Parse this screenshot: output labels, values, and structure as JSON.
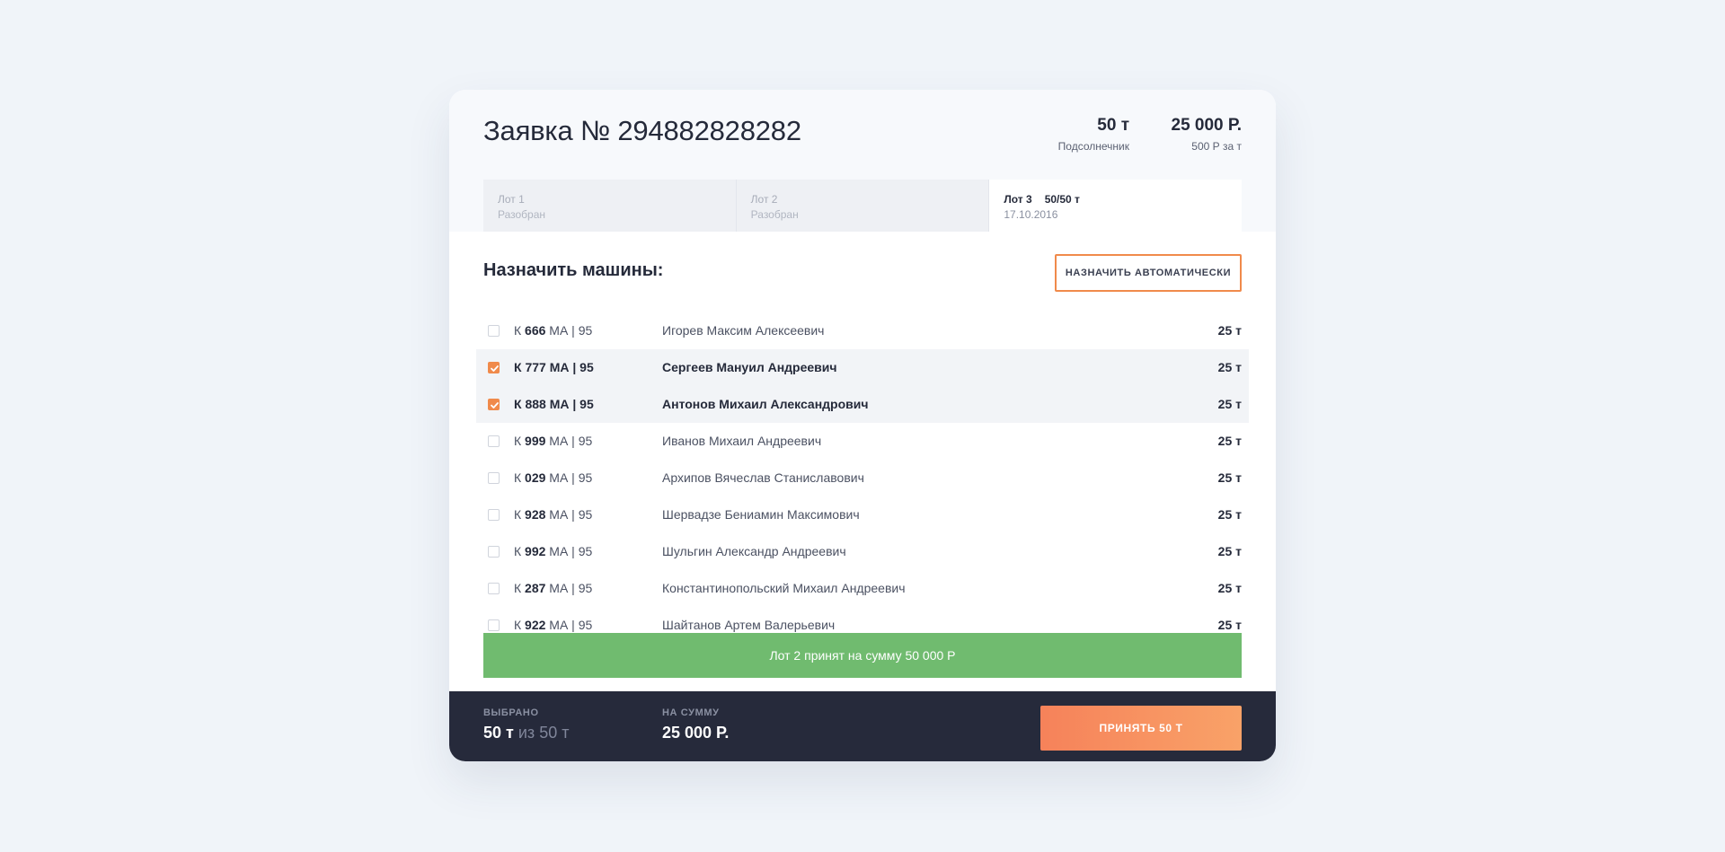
{
  "header": {
    "title": "Заявка № 294882828282",
    "weight_value": "50 т",
    "weight_caption": "Подсолнечник",
    "price_value": "25 000 Р.",
    "price_caption": "500 Р за т"
  },
  "tabs": [
    {
      "title": "Лот 1",
      "capacity": "",
      "subtitle": "Разобран",
      "active": false
    },
    {
      "title": "Лот 2",
      "capacity": "",
      "subtitle": "Разобран",
      "active": false
    },
    {
      "title": "Лот 3",
      "capacity": "50/50 т",
      "subtitle": "17.10.2016",
      "active": true
    }
  ],
  "assign": {
    "title": "Назначить машины:",
    "auto_button": "НАЗНАЧИТЬ АВТОМАТИЧЕСКИ"
  },
  "trucks": [
    {
      "prefix": "К",
      "number": "666",
      "suffix": "МА | 95",
      "driver": "Игорев Максим Алексеевич",
      "weight": "25 т",
      "selected": false
    },
    {
      "prefix": "К",
      "number": "777",
      "suffix": "МА | 95",
      "driver": "Сергеев Мануил Андреевич",
      "weight": "25 т",
      "selected": true
    },
    {
      "prefix": "К",
      "number": "888",
      "suffix": "МА | 95",
      "driver": "Антонов Михаил Александрович",
      "weight": "25 т",
      "selected": true
    },
    {
      "prefix": "К",
      "number": "999",
      "suffix": "МА | 95",
      "driver": "Иванов Михаил Андреевич",
      "weight": "25 т",
      "selected": false
    },
    {
      "prefix": "К",
      "number": "029",
      "suffix": "МА | 95",
      "driver": "Архипов Вячеслав Станиславович",
      "weight": "25 т",
      "selected": false
    },
    {
      "prefix": "К",
      "number": "928",
      "suffix": "МА | 95",
      "driver": "Шервадзе Бениамин Максимович",
      "weight": "25 т",
      "selected": false
    },
    {
      "prefix": "К",
      "number": "992",
      "suffix": "МА | 95",
      "driver": "Шульгин Александр Андреевич",
      "weight": "25 т",
      "selected": false
    },
    {
      "prefix": "К",
      "number": "287",
      "suffix": "МА | 95",
      "driver": "Константинопольский Михаил Андреевич",
      "weight": "25 т",
      "selected": false
    },
    {
      "prefix": "К",
      "number": "922",
      "suffix": "МА | 95",
      "driver": "Шайтанов Артем Валерьевич",
      "weight": "25 т",
      "selected": false
    }
  ],
  "toast": {
    "message": "Лот 2 принят на сумму 50 000 Р"
  },
  "footer": {
    "selected_label": "ВЫБРАНО",
    "selected_value": "50 т",
    "selected_of": "из",
    "selected_total": "50 т",
    "sum_label": "НА СУММУ",
    "sum_value": "25 000 Р.",
    "accept_button": "ПРИНЯТЬ 50 Т"
  },
  "colors": {
    "accent": "#f08a4b",
    "success": "#70bb6f",
    "footer_bg": "#262a3b",
    "page_bg": "#f0f4f9"
  }
}
